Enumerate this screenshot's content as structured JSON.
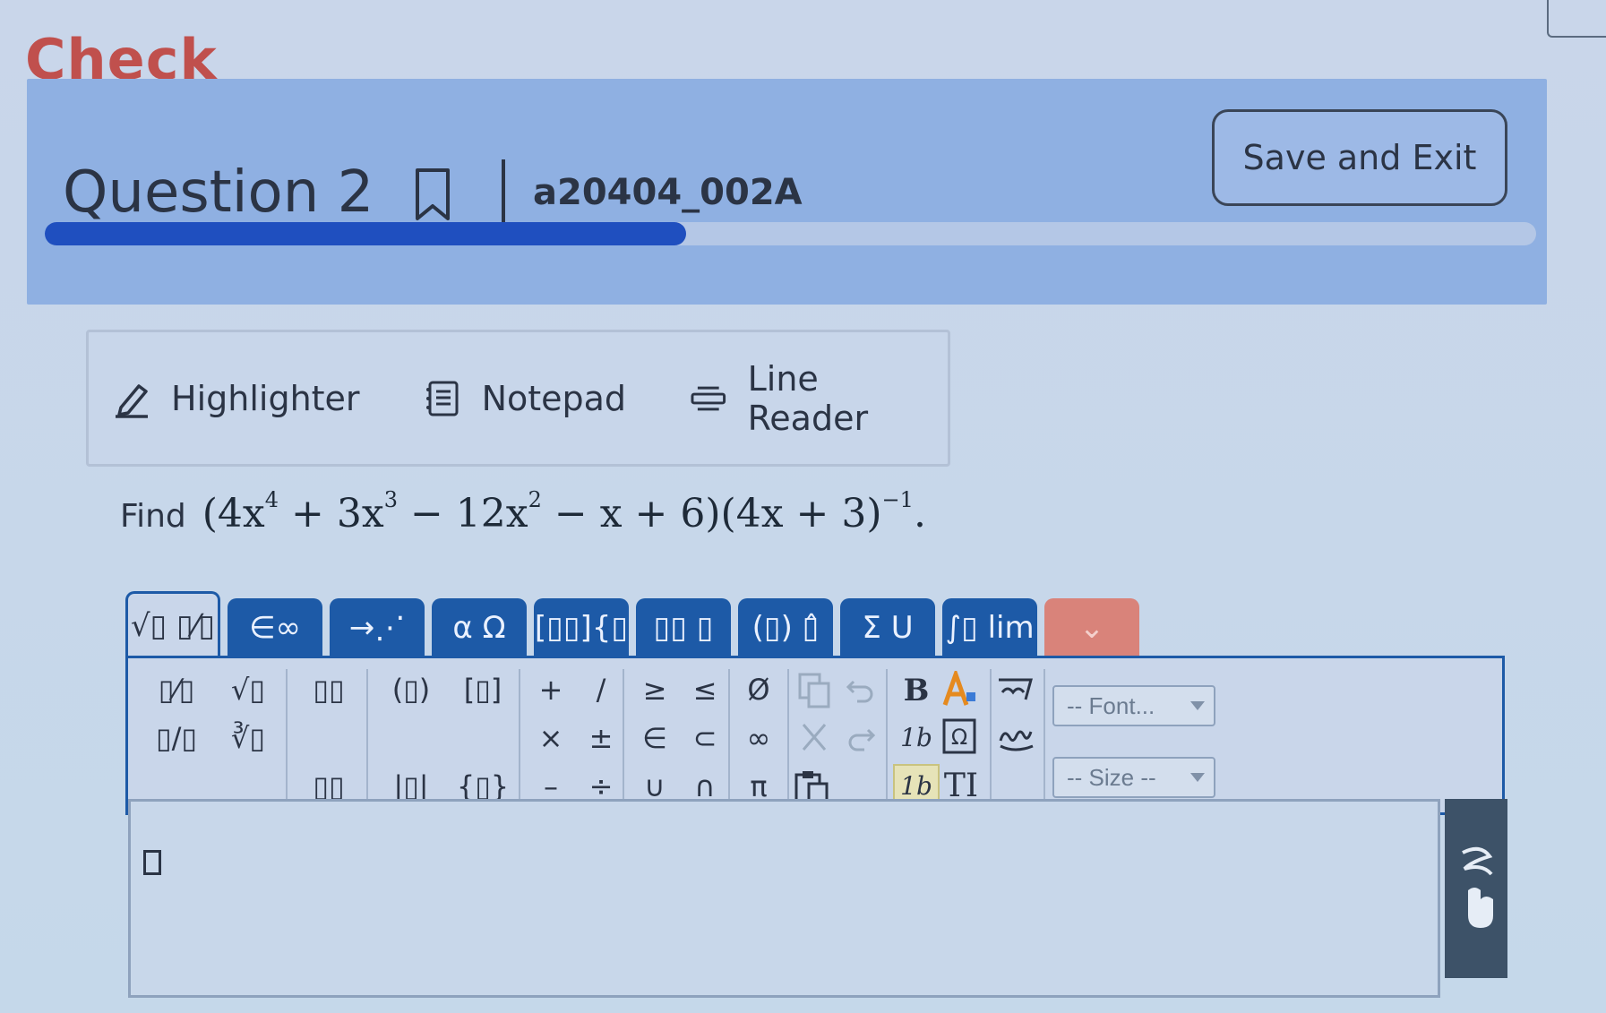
{
  "page": {
    "title": "Check"
  },
  "header": {
    "question_title": "Question 2",
    "question_id": "a20404_002A",
    "save_exit_label": "Save and Exit",
    "progress_fraction": 0.43
  },
  "tools": [
    {
      "label": "Highlighter",
      "icon": "pencil-icon"
    },
    {
      "label": "Notepad",
      "icon": "notepad-icon"
    },
    {
      "label": "Line Reader",
      "icon": "line-reader-icon"
    }
  ],
  "question": {
    "prefix": "Find"
  },
  "editor": {
    "tabs": [
      "√▯ ▯⁄▯",
      "∈∞",
      "→⋰",
      "α Ω",
      "[▯▯]{▯",
      "▯▯ ▯",
      "(▯) ▯̂",
      "Σ U",
      "∫▯ lim",
      "⌄"
    ],
    "basic_group": [
      "▯⁄▯",
      "√▯",
      "▯/▯",
      "∛▯"
    ],
    "power_group": [
      "▯▯",
      "▯▯"
    ],
    "bracket_group": [
      "(▯)",
      "[▯]",
      "|▯|",
      "{▯}"
    ],
    "ops_group": [
      "+",
      "/",
      "×",
      "±",
      "–",
      "÷"
    ],
    "rel_group": [
      "≥",
      "≤",
      "∈",
      "⊂",
      "∪",
      "∩"
    ],
    "const_group": [
      "Ø",
      "∞",
      "π"
    ],
    "font_select": "-- Font...",
    "size_select": "-- Size --"
  }
}
